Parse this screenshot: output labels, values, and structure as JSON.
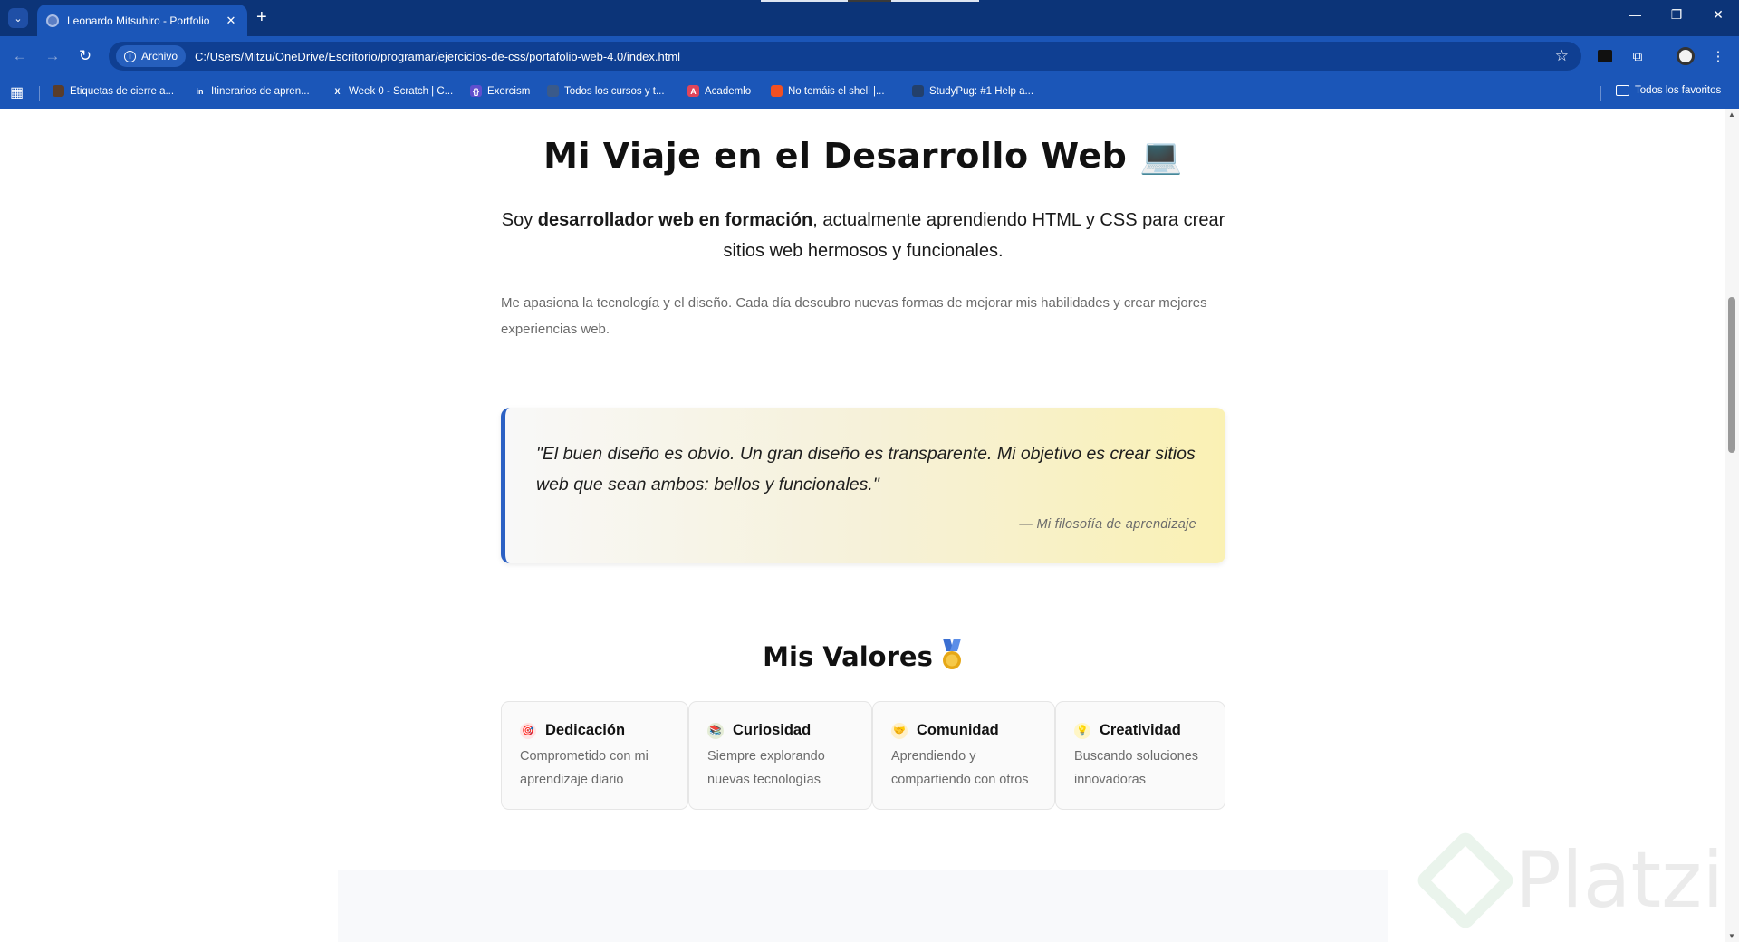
{
  "browser": {
    "tab_title": "Leonardo Mitsuhiro - Portfolio",
    "close_glyph": "✕",
    "new_tab_glyph": "+",
    "search_tabs_glyph": "⌄",
    "window_controls": {
      "minimize": "—",
      "restore": "❐",
      "close": "✕"
    },
    "nav": {
      "back": "←",
      "forward": "→",
      "reload": "↻"
    },
    "site_info_label": "Archivo",
    "url": "C:/Users/Mitzu/OneDrive/Escritorio/programar/ejercicios-de-css/portafolio-web-4.0/index.html",
    "star_glyph": "☆",
    "extensions_glyph": "⧉",
    "menu_glyph": "⋮",
    "apps_glyph": "▦",
    "bookmarks": [
      {
        "label": "Etiquetas de cierre a...",
        "icon": "document-icon",
        "color": "#5a3d2b",
        "glyph": ""
      },
      {
        "label": "Itinerarios de apren...",
        "icon": "linkedin-icon",
        "color": "#1b56b8",
        "glyph": "in"
      },
      {
        "label": "Week 0 - Scratch | C...",
        "icon": "x-icon",
        "color": "#1b56b8",
        "glyph": "X"
      },
      {
        "label": "Exercism",
        "icon": "exercism-icon",
        "color": "#604fcd",
        "glyph": "{}"
      },
      {
        "label": "Todos los cursos y t...",
        "icon": "document-icon",
        "color": "#3a5a8a",
        "glyph": ""
      },
      {
        "label": "Academlo",
        "icon": "academlo-icon",
        "color": "#e0455a",
        "glyph": "A"
      },
      {
        "label": "No temáis el shell |...",
        "icon": "microsoft-icon",
        "color": "#f25022",
        "glyph": ""
      },
      {
        "label": "StudyPug: #1 Help a...",
        "icon": "studypug-icon",
        "color": "#23406b",
        "glyph": ""
      }
    ],
    "all_bookmarks_label": "Todos los favoritos"
  },
  "page": {
    "heading": "Mi Viaje en el Desarrollo Web 💻",
    "lead_prefix": "Soy ",
    "lead_bold": "desarrollador web en formación",
    "lead_suffix": ", actualmente aprendiendo HTML y CSS para crear sitios web hermosos y funcionales.",
    "paragraph": "Me apasiona la tecnología y el diseño. Cada día descubro nuevas formas de mejorar mis habilidades y crear mejores experiencias web.",
    "quote_text": "\"El buen diseño es obvio. Un gran diseño es transparente. Mi objetivo es crear sitios web que sean ambos: bellos y funcionales.\"",
    "quote_source": "— Mi filosofía de aprendizaje",
    "values_heading": "Mis Valores",
    "values": [
      {
        "title": "Dedicación",
        "desc": "Comprometido con mi aprendizaje diario",
        "icon": "target-icon",
        "glyph": "🎯"
      },
      {
        "title": "Curiosidad",
        "desc": "Siempre explorando nuevas tecnologías",
        "icon": "books-icon",
        "glyph": "📚"
      },
      {
        "title": "Comunidad",
        "desc": "Aprendiendo y compartiendo con otros",
        "icon": "handshake-icon",
        "glyph": "🤝"
      },
      {
        "title": "Creatividad",
        "desc": "Buscando soluciones innovadoras",
        "icon": "lightbulb-icon",
        "glyph": "💡"
      }
    ]
  },
  "watermark": {
    "text": "Platzi"
  }
}
